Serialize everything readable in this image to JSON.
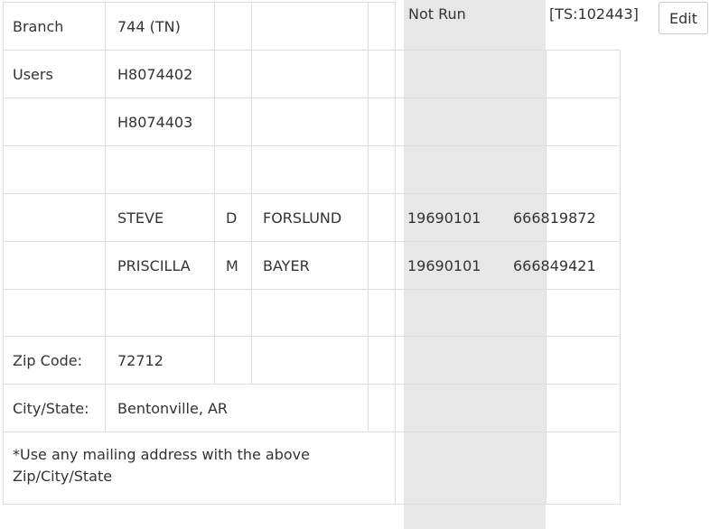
{
  "left_table": {
    "rows": [
      {
        "label": "Branch",
        "value": "744 (TN)"
      },
      {
        "label": "Users",
        "value": "H8074402"
      },
      {
        "label": "",
        "value": "H8074403"
      },
      {
        "label": "",
        "value": ""
      },
      {
        "label": "",
        "first": "STEVE",
        "middle": "D",
        "last": "FORSLUND",
        "dob": "19690101",
        "ssn": "666819872"
      },
      {
        "label": "",
        "first": "PRISCILLA",
        "middle": "M",
        "last": "BAYER",
        "dob": "19690101",
        "ssn": "666849421"
      },
      {
        "label": "",
        "value": ""
      },
      {
        "label": "Zip Code:",
        "value": "72712"
      },
      {
        "label": "City/State:",
        "value": "Bentonville, AR"
      }
    ],
    "note": "*Use any mailing address with the above Zip/City/State"
  },
  "status": {
    "text": "Not Run",
    "ticket": "[TS:102443]"
  },
  "edit_button": {
    "label": "Edit"
  }
}
